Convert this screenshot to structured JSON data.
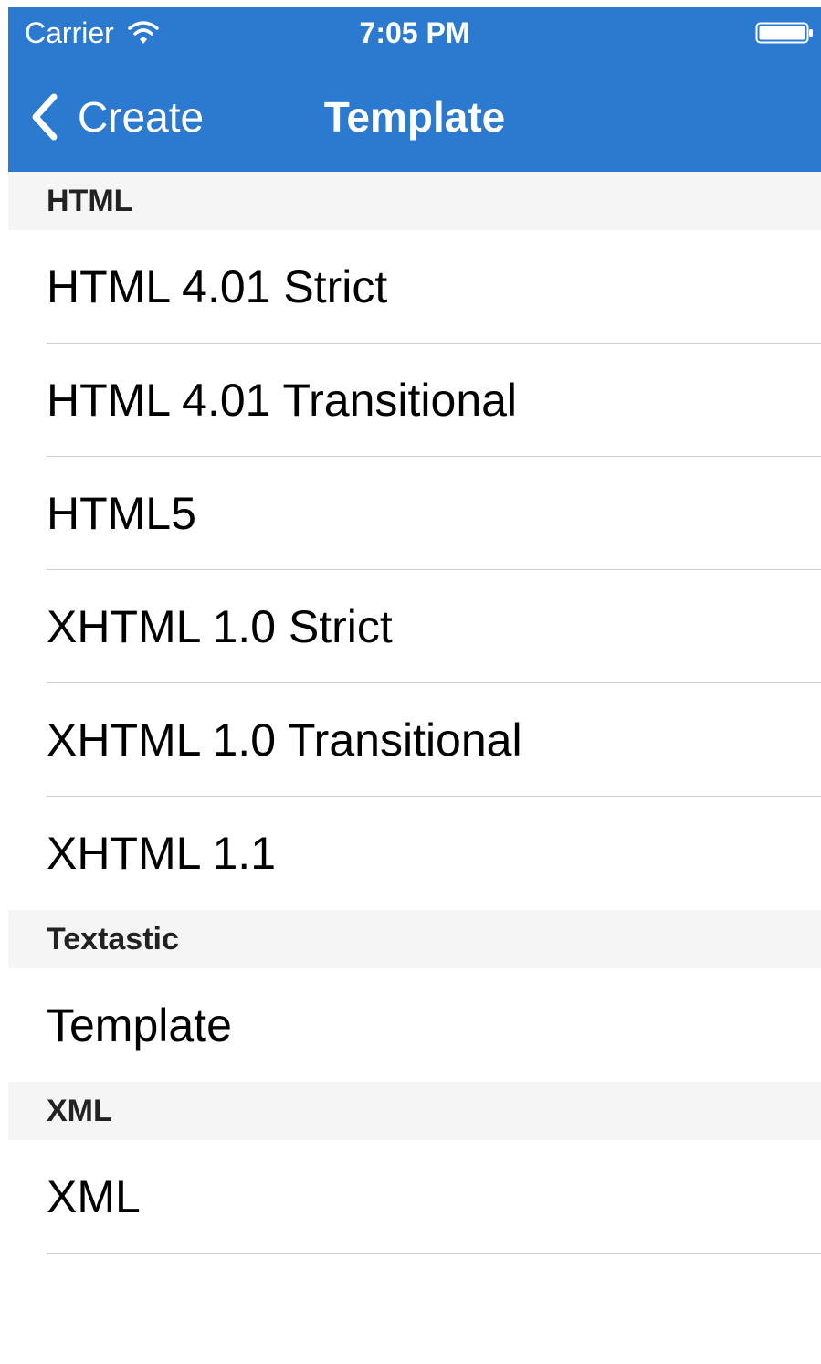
{
  "status_bar": {
    "carrier": "Carrier",
    "time": "7:05 PM"
  },
  "nav": {
    "back_label": "Create",
    "title": "Template"
  },
  "sections": [
    {
      "header": "HTML",
      "items": [
        "HTML 4.01 Strict",
        "HTML 4.01 Transitional",
        "HTML5",
        "XHTML 1.0 Strict",
        "XHTML 1.0 Transitional",
        "XHTML 1.1"
      ]
    },
    {
      "header": "Textastic",
      "items": [
        "Template"
      ]
    },
    {
      "header": "XML",
      "items": [
        "XML"
      ]
    }
  ],
  "colors": {
    "nav_background": "#2b7ad0",
    "section_background": "#f5f5f5",
    "separator": "#cfcfcf"
  }
}
